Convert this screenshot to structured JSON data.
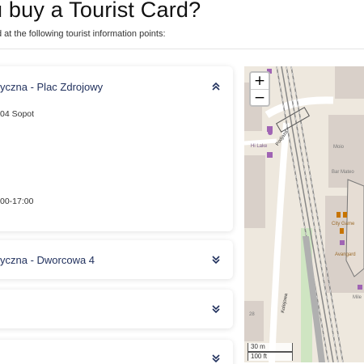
{
  "header": {
    "title": "u buy a Tourist Card?",
    "subtitle": "d at the following tourist information points:"
  },
  "cards": [
    {
      "title": "yczna - Plac Zdrojowy",
      "expanded": true,
      "address": "04 Sopot",
      "hours": "00-17:00",
      "toggle_icon": "chevron-up-double-icon"
    },
    {
      "title": "yczna - Dworcowa 4",
      "expanded": false,
      "toggle_icon": "chevron-down-double-icon"
    },
    {
      "title": "",
      "expanded": false,
      "toggle_icon": "chevron-down-double-icon"
    },
    {
      "title": "",
      "expanded": false,
      "toggle_icon": "chevron-down-double-icon"
    }
  ],
  "map": {
    "zoom_in_label": "+",
    "zoom_out_label": "−",
    "scale_metric": "30 m",
    "scale_imperial": "100 ft",
    "labels": {
      "street_1": "Podjazd",
      "street_2": "Kolejowa",
      "poi_1": "Hi Lake",
      "poi_2": "Moio",
      "poi_3": "Bar Mateo",
      "poi_4": "City Game",
      "poi_5": "Avangard",
      "poi_6": "Mile",
      "poi_7": "28"
    },
    "colors": {
      "land": "#eee8de",
      "building": "#d9d0c9",
      "rail": "#999999",
      "road": "#ffffff",
      "poi": "#a064b4",
      "food": "#c77400"
    }
  },
  "accent_color": "#1f2f5c"
}
